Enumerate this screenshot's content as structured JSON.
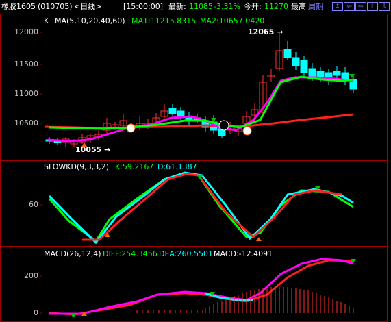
{
  "header": {
    "symbol": "橡胶1605",
    "code": "(010705)",
    "period": "<日线>",
    "time": "[15:00:00]",
    "latest_label": "最新:",
    "latest": "11085",
    "change": "-3.31%",
    "open_label": "今开:",
    "open": "11270",
    "high_label": "最高",
    "period_link": "周期",
    "nav": [
      "↕",
      "⇦",
      "⇨",
      "⇧",
      "⇩"
    ]
  },
  "main_panel": {
    "k_label": "K",
    "ma_label": "MA(5,10,20,40,60)",
    "ma1": "MA1:11215.8315",
    "ma2": "MA2:10657.0420",
    "high_marker": "12065",
    "low_marker": "10055",
    "y_ticks": [
      "12000",
      "11500",
      "11000",
      "10500"
    ]
  },
  "kd_panel": {
    "title": "SLOWKD(9,3,3,2)",
    "k": "K:59.2167",
    "d": "D:61.1387",
    "y_ticks": [
      "60"
    ]
  },
  "macd_panel": {
    "title": "MACD(26,12,4)",
    "diff": "DIFF:254.3456",
    "dea": "DEA:260.5501",
    "macd": "MACD:-12.4091",
    "y_ticks": [
      "200",
      "0"
    ]
  },
  "colors": {
    "up": "#ff3030",
    "down": "#00ffff",
    "ma_magenta": "#ff00ff",
    "ma_green": "#00ff00",
    "ma_red": "#ff2020",
    "border": "#a00000",
    "label_green": "#00ff00",
    "label_blue": "#00ffff"
  }
}
